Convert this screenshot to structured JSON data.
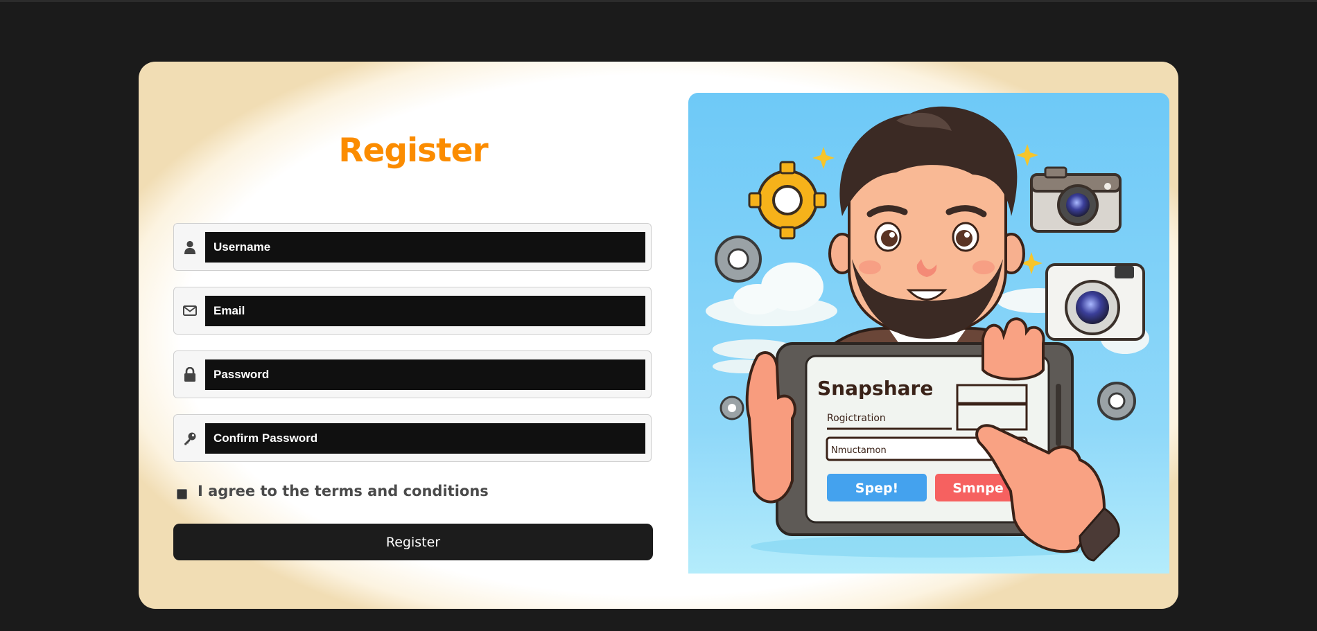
{
  "form": {
    "title": "Register",
    "fields": [
      {
        "icon": "user-icon",
        "placeholder": "Username"
      },
      {
        "icon": "envelope-icon",
        "placeholder": "Email"
      },
      {
        "icon": "lock-icon",
        "placeholder": "Password"
      },
      {
        "icon": "key-icon",
        "placeholder": "Confirm Password"
      }
    ],
    "agree_label": "I agree to the terms and conditions",
    "agree_checked": false,
    "submit_label": "Register"
  },
  "illustration": {
    "tablet_title": "Snapshare",
    "tablet_label_1": "Rogictration",
    "tablet_label_2": "Nmuctamon",
    "tablet_button_1": "Spep!",
    "tablet_button_2": "Smnpe"
  },
  "colors": {
    "page_background": "#1b1b1b",
    "accent": "#fb8c00",
    "input_background": "#101010",
    "button_background": "#1c1c1c",
    "sky": "#72cdf8"
  }
}
